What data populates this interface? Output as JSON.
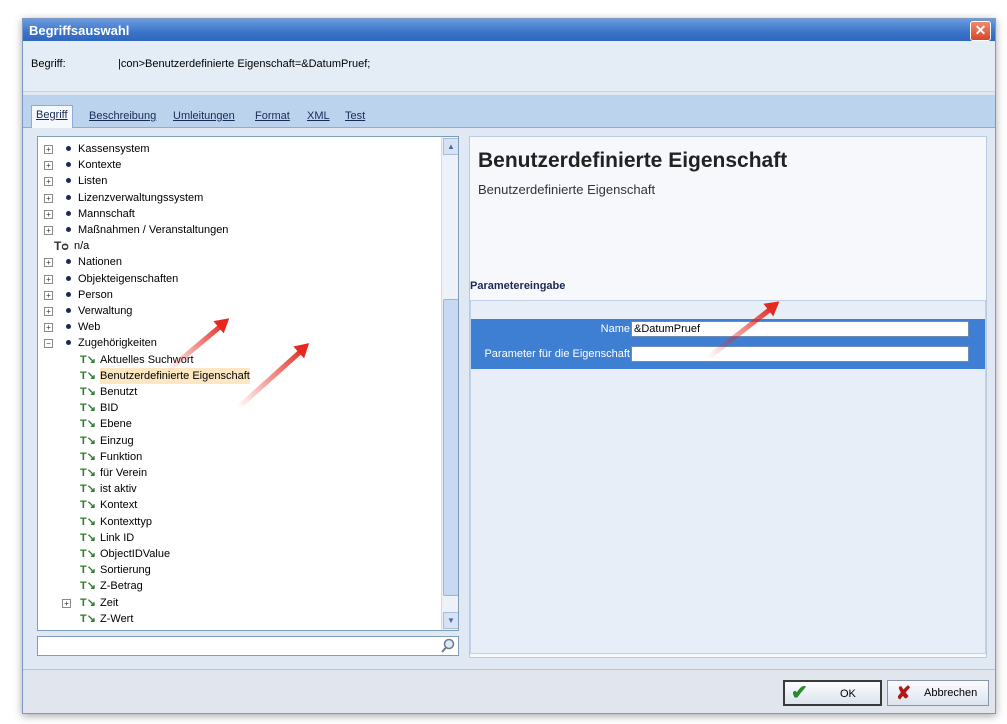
{
  "window": {
    "title": "Begriffsauswahl"
  },
  "term": {
    "label": "Begriff:",
    "value": "|con>Benutzerdefinierte Eigenschaft=&DatumPruef;"
  },
  "tabs": [
    {
      "label": "Begriff",
      "active": true
    },
    {
      "label": "Beschreibung",
      "active": false
    },
    {
      "label": "Umleitungen",
      "active": false
    },
    {
      "label": "Format",
      "active": false
    },
    {
      "label": "XML",
      "active": false
    },
    {
      "label": "Test",
      "active": false
    }
  ],
  "tree": {
    "items": [
      {
        "label": "Kassensystem",
        "type": "folder",
        "expandable": true
      },
      {
        "label": "Kontexte",
        "type": "folder",
        "expandable": true
      },
      {
        "label": "Listen",
        "type": "folder",
        "expandable": true
      },
      {
        "label": "Lizenzverwaltungssystem",
        "type": "folder",
        "expandable": true
      },
      {
        "label": "Mannschaft",
        "type": "folder",
        "expandable": true
      },
      {
        "label": "Maßnahmen / Veranstaltungen",
        "type": "folder",
        "expandable": true
      },
      {
        "label": "n/a",
        "type": "term-root",
        "expandable": false
      },
      {
        "label": "Nationen",
        "type": "folder",
        "expandable": true
      },
      {
        "label": "Objekteigenschaften",
        "type": "folder",
        "expandable": true
      },
      {
        "label": "Person",
        "type": "folder",
        "expandable": true
      },
      {
        "label": "Verwaltung",
        "type": "folder",
        "expandable": true
      },
      {
        "label": "Web",
        "type": "folder",
        "expandable": true
      },
      {
        "label": "Zugehörigkeiten",
        "type": "folder",
        "expandable": true,
        "expanded": true
      },
      {
        "label": "Aktuelles Suchwort",
        "type": "term"
      },
      {
        "label": "Benutzerdefinierte Eigenschaft",
        "type": "term",
        "selected": true
      },
      {
        "label": "Benutzt",
        "type": "term"
      },
      {
        "label": "BID",
        "type": "term"
      },
      {
        "label": "Ebene",
        "type": "term"
      },
      {
        "label": "Einzug",
        "type": "term"
      },
      {
        "label": "Funktion",
        "type": "term"
      },
      {
        "label": "für Verein",
        "type": "term"
      },
      {
        "label": "ist aktiv",
        "type": "term"
      },
      {
        "label": "Kontext",
        "type": "term"
      },
      {
        "label": "Kontexttyp",
        "type": "term"
      },
      {
        "label": "Link ID",
        "type": "term"
      },
      {
        "label": "ObjectIDValue",
        "type": "term"
      },
      {
        "label": "Sortierung",
        "type": "term"
      },
      {
        "label": "Z-Betrag",
        "type": "term"
      },
      {
        "label": "Zeit",
        "type": "term",
        "expandable": true
      },
      {
        "label": "Z-Wert",
        "type": "term"
      }
    ]
  },
  "search": {
    "value": ""
  },
  "detail": {
    "heading": "Benutzerdefinierte Eigenschaft",
    "subheading": "Benutzerdefinierte Eigenschaft",
    "params_title": "Parametereingabe",
    "params": [
      {
        "label": "Name",
        "value": "&DatumPruef"
      },
      {
        "label": "Parameter für die Eigenschaft",
        "value": ""
      }
    ]
  },
  "footer": {
    "ok_label": "OK",
    "cancel_label": "Abbrechen"
  },
  "icons": {
    "close": "close-icon",
    "check": "check-icon",
    "cancel": "cancel-x-icon",
    "search": "magnifier-icon",
    "scroll_up": "chevron-up-icon",
    "scroll_down": "chevron-down-icon"
  },
  "colors": {
    "titlebar": "#3b74c9",
    "param_band": "#3e7fd3",
    "selected_item": "#fde7c2",
    "arrow": "#e6281e"
  }
}
